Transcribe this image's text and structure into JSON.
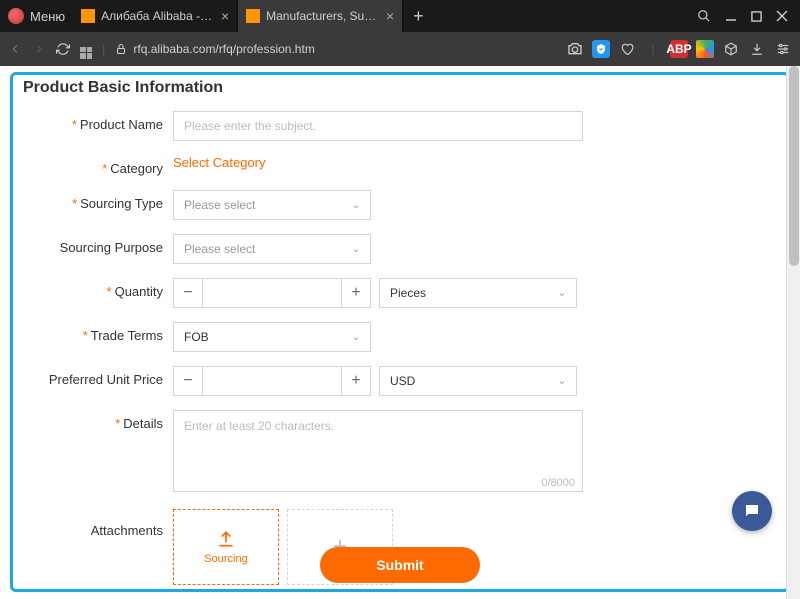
{
  "browser": {
    "menu_label": "Меню",
    "tabs": [
      {
        "title": "Алибаба Alibaba - крупне",
        "active": false
      },
      {
        "title": "Manufacturers, Suppliers, E",
        "active": true
      }
    ],
    "url": "rfq.alibaba.com/rfq/profession.htm",
    "abp_label": "ABP"
  },
  "panel": {
    "title": "Product Basic Information"
  },
  "form": {
    "product_name": {
      "label": "Product Name",
      "placeholder": "Please enter the subject."
    },
    "category": {
      "label": "Category",
      "link": "Select Category"
    },
    "sourcing_type": {
      "label": "Sourcing Type",
      "placeholder": "Please select"
    },
    "sourcing_purpose": {
      "label": "Sourcing Purpose",
      "placeholder": "Please select"
    },
    "quantity": {
      "label": "Quantity",
      "unit": "Pieces"
    },
    "trade_terms": {
      "label": "Trade Terms",
      "value": "FOB"
    },
    "unit_price": {
      "label": "Preferred Unit Price",
      "currency": "USD"
    },
    "details": {
      "label": "Details",
      "placeholder": "Enter at least 20 characters.",
      "counter": "0/8000"
    },
    "attachments": {
      "label": "Attachments",
      "sourcing": "Sourcing"
    },
    "submit": "Submit"
  }
}
